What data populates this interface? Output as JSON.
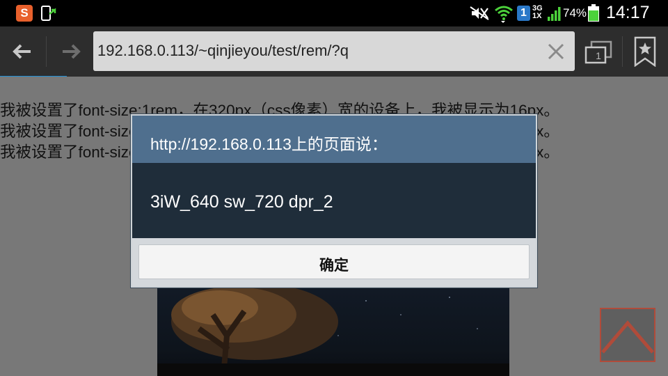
{
  "status_bar": {
    "app_icon_1_letter": "S",
    "sim_slot": "1",
    "network_type_top": "3G",
    "network_type_bottom": "1X",
    "battery_percent": "74%",
    "clock": "14:17",
    "icons": [
      "sogou-input-icon",
      "screen-rotate-icon",
      "mute-icon",
      "wifi-icon",
      "sim-icon",
      "signal-icon",
      "battery-icon"
    ]
  },
  "browser": {
    "url": "192.168.0.113/~qinjieyou/test/rem/?q",
    "tab_count": "1",
    "progress_fraction": 0.1,
    "accent_color": "#1e90d8"
  },
  "page": {
    "lines": [
      "我被设置了font-size:1rem，在320px（css像素）宽的设备上，我被显示为16px。",
      "我被设置了font-size:1rem，在320px（css像素）宽的设备上，我被显示为16px。",
      "我被设置了font-size:1rem，在320px（css像素）宽的设备上，我被显示为16px。"
    ]
  },
  "dialog": {
    "title": "http://192.168.0.113上的页面说：",
    "message": "3iW_640  sw_720  dpr_2",
    "ok_label": "确定"
  }
}
